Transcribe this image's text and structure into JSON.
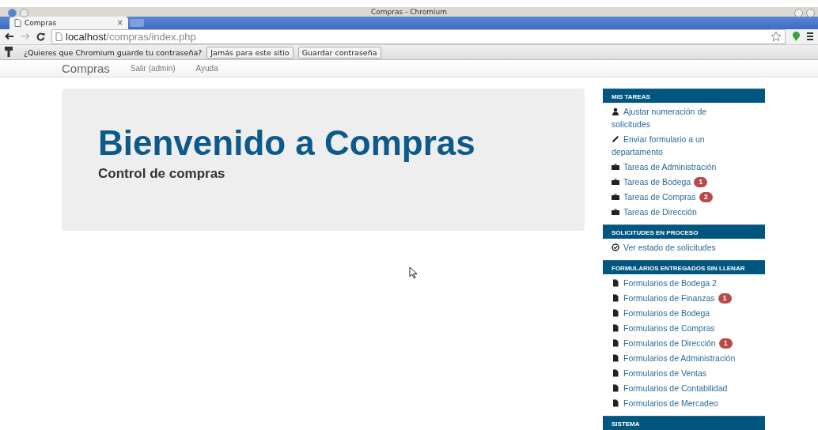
{
  "window": {
    "title": "Compras - Chromium"
  },
  "tabs": [
    {
      "label": "Compras",
      "close": "×",
      "selected": true
    }
  ],
  "address_bar": {
    "host": "localhost",
    "path": "/compras/index.php"
  },
  "infobar": {
    "message": "¿Quieres que Chromium guarde tu contraseña?",
    "buttons": [
      "Jamás para este sitio",
      "Guardar contraseña"
    ]
  },
  "navbar": {
    "brand": "Compras",
    "links": [
      "Salir (admin)",
      "Ayuda"
    ]
  },
  "jumbotron": {
    "title": "Bienvenido a Compras",
    "subtitle": "Control de compras"
  },
  "sidebar": [
    {
      "heading": "MIS TAREAS",
      "items": [
        {
          "kind": "person",
          "label": "Ajustar numeración de solicitudes"
        },
        {
          "kind": "edit",
          "label": "Enviar formulario a un departamento"
        },
        {
          "kind": "task",
          "label": "Tareas de Administración"
        },
        {
          "kind": "task",
          "label": "Tareas de Bodega",
          "badge": "1"
        },
        {
          "kind": "task",
          "label": "Tareas de Compras",
          "badge": "2"
        },
        {
          "kind": "task",
          "label": "Tareas de Dirección"
        }
      ]
    },
    {
      "heading": "SOLICITUDES EN PROCESO",
      "items": [
        {
          "kind": "status",
          "label": "Ver estado de solicitudes"
        }
      ]
    },
    {
      "heading": "FORMULARIOS ENTREGADOS SIN LLENAR",
      "items": [
        {
          "kind": "form",
          "label": "Formularios de Bodega 2"
        },
        {
          "kind": "form",
          "label": "Formularios de Finanzas",
          "badge": "1"
        },
        {
          "kind": "form",
          "label": "Formularios de Bodega"
        },
        {
          "kind": "form",
          "label": "Formularios de Compras"
        },
        {
          "kind": "form",
          "label": "Formularios de Dirección",
          "badge": "1"
        },
        {
          "kind": "form",
          "label": "Formularios de Administración"
        },
        {
          "kind": "form",
          "label": "Formularios de Ventas"
        },
        {
          "kind": "form",
          "label": "Formularios de Contabilidad"
        },
        {
          "kind": "form",
          "label": "Formularios de Mercadeo"
        }
      ]
    },
    {
      "heading": "SISTEMA"
    }
  ]
}
